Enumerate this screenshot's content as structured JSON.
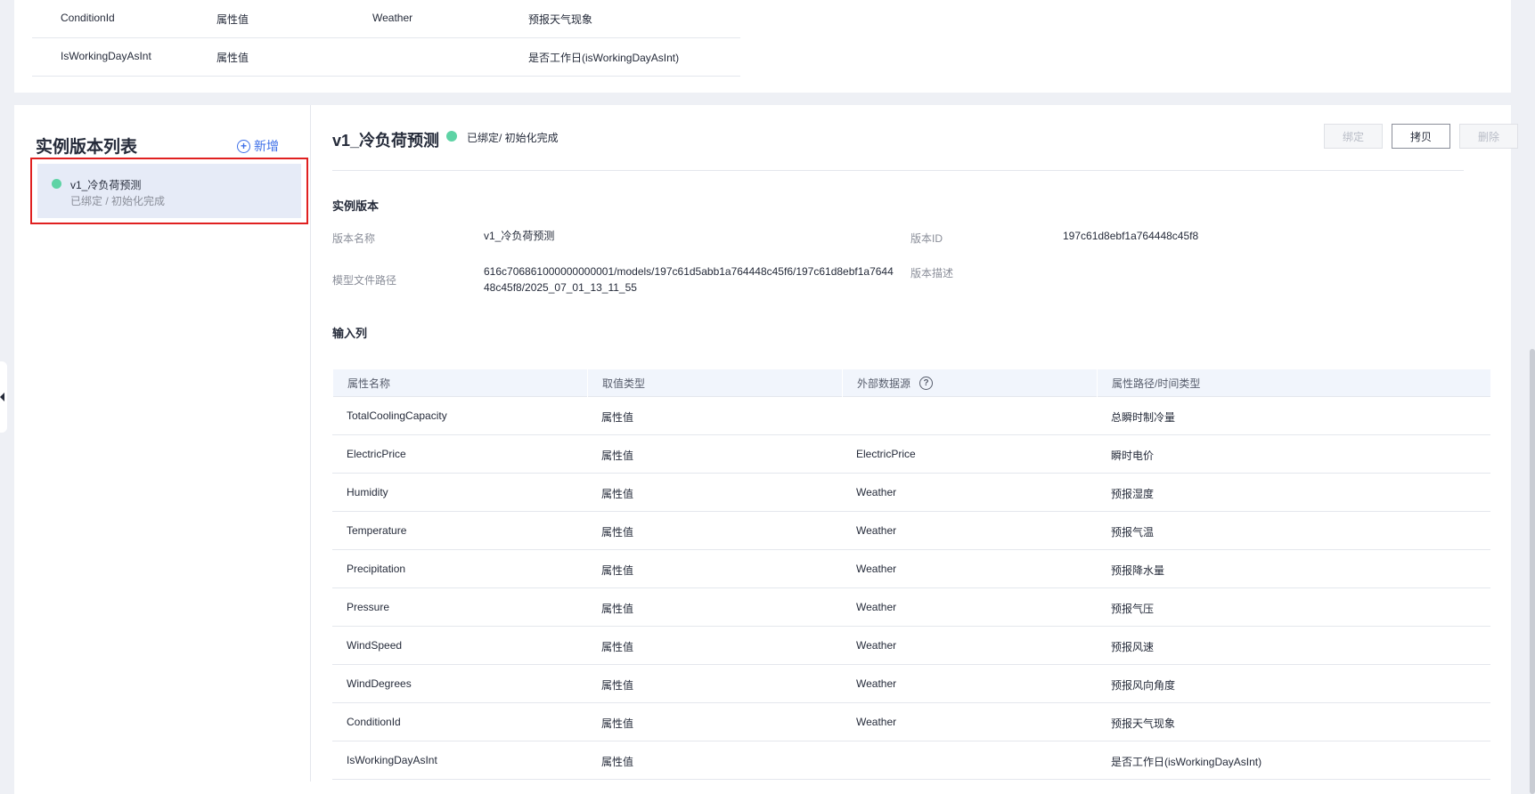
{
  "top_table": {
    "rows": [
      {
        "name": "ConditionId",
        "type": "属性值",
        "source": "Weather",
        "path": "预报天气现象"
      },
      {
        "name": "IsWorkingDayAsInt",
        "type": "属性值",
        "source": "",
        "path": "是否工作日(isWorkingDayAsInt)"
      }
    ]
  },
  "left_panel": {
    "title": "实例版本列表",
    "add_label": "新增",
    "items": [
      {
        "name": "v1_冷负荷预测",
        "status": "已绑定 / 初始化完成"
      }
    ]
  },
  "detail": {
    "title": "v1_冷负荷预测",
    "status": "已绑定/ 初始化完成",
    "status_color": "#5ed3a5",
    "buttons": {
      "bind": "绑定",
      "copy": "拷贝",
      "delete": "删除"
    },
    "section_version": "实例版本",
    "fields": {
      "version_name_label": "版本名称",
      "version_name": "v1_冷负荷预测",
      "version_id_label": "版本ID",
      "version_id": "197c61d8ebf1a764448c45f8",
      "model_path_label": "模型文件路径",
      "model_path_line1": "616c706861000000000001/models/197c61d5abb1a764448c45f6/197c61d8ebf1a7644",
      "model_path_line2": "48c45f8/2025_07_01_13_11_55",
      "version_desc_label": "版本描述"
    },
    "section_input": "输入列",
    "input_table": {
      "headers": [
        "属性名称",
        "取值类型",
        "外部数据源",
        "属性路径/时间类型"
      ],
      "rows": [
        {
          "name": "TotalCoolingCapacity",
          "type": "属性值",
          "source": "",
          "path": "总瞬时制冷量"
        },
        {
          "name": "ElectricPrice",
          "type": "属性值",
          "source": "ElectricPrice",
          "path": "瞬时电价"
        },
        {
          "name": "Humidity",
          "type": "属性值",
          "source": "Weather",
          "path": "预报湿度"
        },
        {
          "name": "Temperature",
          "type": "属性值",
          "source": "Weather",
          "path": "预报气温"
        },
        {
          "name": "Precipitation",
          "type": "属性值",
          "source": "Weather",
          "path": "预报降水量"
        },
        {
          "name": "Pressure",
          "type": "属性值",
          "source": "Weather",
          "path": "预报气压"
        },
        {
          "name": "WindSpeed",
          "type": "属性值",
          "source": "Weather",
          "path": "预报风速"
        },
        {
          "name": "WindDegrees",
          "type": "属性值",
          "source": "Weather",
          "path": "预报风向角度"
        },
        {
          "name": "ConditionId",
          "type": "属性值",
          "source": "Weather",
          "path": "预报天气现象"
        },
        {
          "name": "IsWorkingDayAsInt",
          "type": "属性值",
          "source": "",
          "path": "是否工作日(isWorkingDayAsInt)"
        }
      ]
    }
  }
}
